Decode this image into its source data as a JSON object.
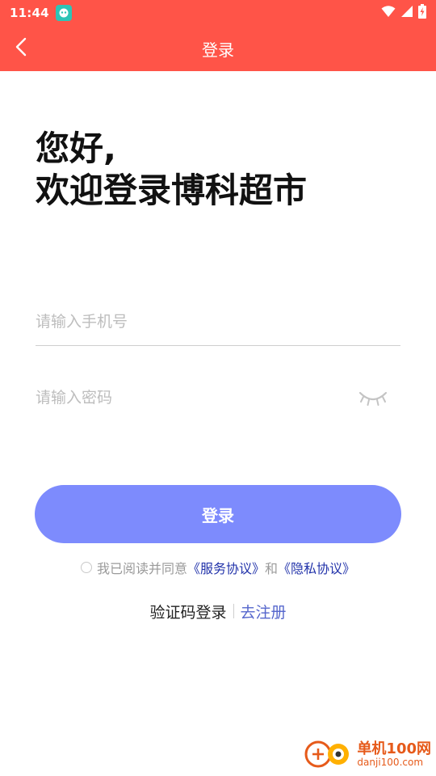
{
  "status_bar": {
    "time": "11:44"
  },
  "header": {
    "title": "登录"
  },
  "greeting": {
    "line1": "您好,",
    "line2": "欢迎登录博科超市"
  },
  "form": {
    "phone_placeholder": "请输入手机号",
    "password_placeholder": "请输入密码"
  },
  "login_button": {
    "label": "登录"
  },
  "agreement": {
    "prefix": "我已阅读并同意",
    "service_link": "《服务协议》",
    "conjunction": "和",
    "privacy_link": "《隐私协议》"
  },
  "bottom_links": {
    "code_login": "验证码登录",
    "register": "去注册"
  },
  "watermark": {
    "name": "单机100网",
    "url": "danji100.com"
  },
  "colors": {
    "header_red": "#FF5448",
    "login_button": "#7D8BFD",
    "agreement_link": "#2233aa",
    "register_link": "#5566cc"
  }
}
